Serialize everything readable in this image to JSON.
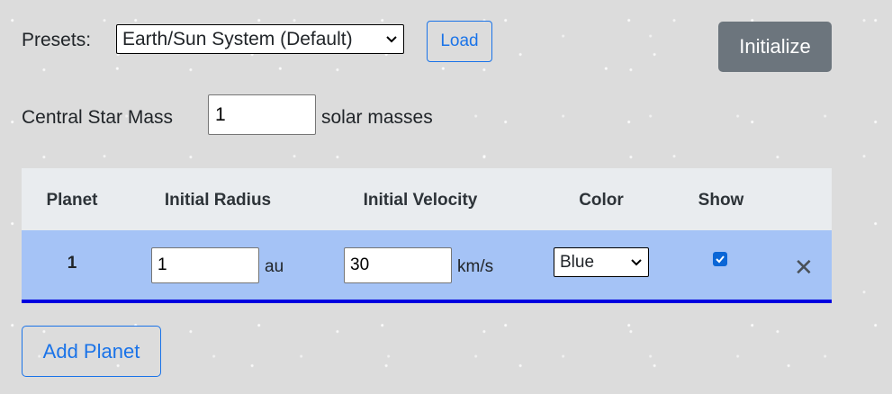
{
  "presets": {
    "label": "Presets:",
    "selected": "Earth/Sun System (Default)",
    "load_label": "Load"
  },
  "initialize_label": "Initialize",
  "central_star": {
    "label": "Central Star Mass",
    "value": "1",
    "unit": "solar masses"
  },
  "table": {
    "headers": [
      "Planet",
      "Initial Radius",
      "Initial Velocity",
      "Color",
      "Show"
    ],
    "rows": [
      {
        "planet": "1",
        "radius": "1",
        "radius_unit": "au",
        "velocity": "30",
        "velocity_unit": "km/s",
        "color": "Blue",
        "show": true
      }
    ]
  },
  "add_planet_label": "Add Planet",
  "colors": {
    "accent": "#1a73e8",
    "row_background": "#a5c3f6",
    "row_border": "#0000e0",
    "header_background": "#e9ecef",
    "initialize_button": "#6c757d"
  }
}
